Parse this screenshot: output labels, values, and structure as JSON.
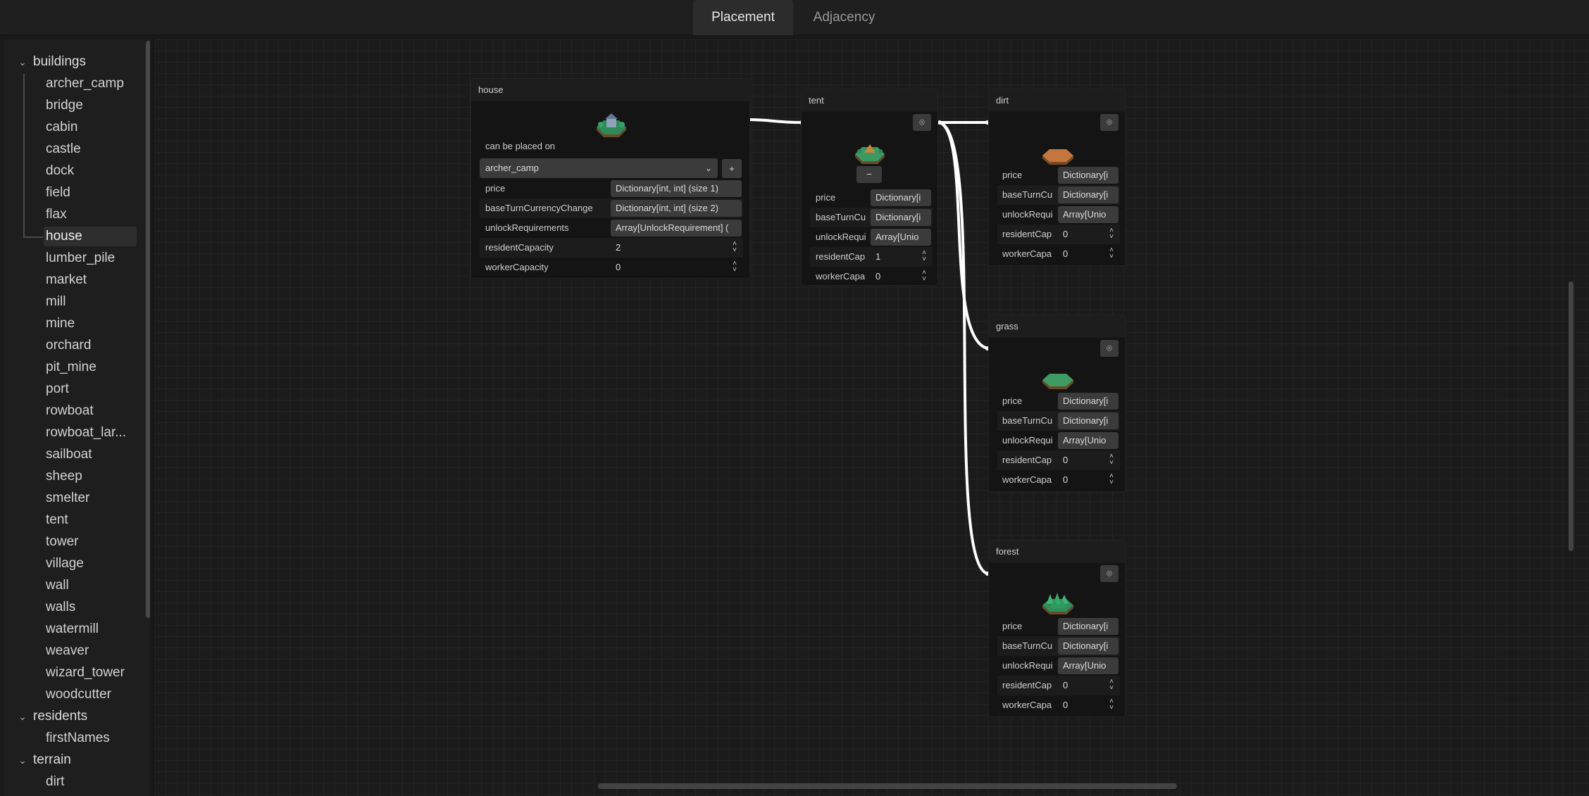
{
  "tabs": [
    {
      "label": "Placement",
      "active": true
    },
    {
      "label": "Adjacency",
      "active": false
    }
  ],
  "tree": {
    "groups": [
      {
        "label": "buildings",
        "items": [
          "archer_camp",
          "bridge",
          "cabin",
          "castle",
          "dock",
          "field",
          "flax",
          "house",
          "lumber_pile",
          "market",
          "mill",
          "mine",
          "orchard",
          "pit_mine",
          "port",
          "rowboat",
          "rowboat_lar...",
          "sailboat",
          "sheep",
          "smelter",
          "tent",
          "tower",
          "village",
          "wall",
          "walls",
          "watermill",
          "weaver",
          "wizard_tower",
          "woodcutter"
        ]
      },
      {
        "label": "residents",
        "items": [
          "firstNames"
        ]
      },
      {
        "label": "terrain",
        "items": [
          "dirt"
        ]
      }
    ],
    "selected": "house"
  },
  "nodes": {
    "house": {
      "title": "house",
      "can_place_label": "can be placed on",
      "select_value": "archer_camp",
      "add_label": "+",
      "props": [
        {
          "label": "price",
          "value": "Dictionary[int, int] (size 1)"
        },
        {
          "label": "baseTurnCurrencyChange",
          "value": "Dictionary[int, int] (size 2)"
        },
        {
          "label": "unlockRequirements",
          "value": "Array[UnlockRequirement] ("
        },
        {
          "label": "residentCapacity",
          "value": "2"
        },
        {
          "label": "workerCapacity",
          "value": "0"
        }
      ]
    },
    "tent": {
      "title": "tent",
      "minus_label": "−",
      "props": [
        {
          "label": "price",
          "value": "Dictionary[i"
        },
        {
          "label": "baseTurnCu",
          "value": "Dictionary[i"
        },
        {
          "label": "unlockRequi",
          "value": "Array[Unio"
        },
        {
          "label": "residentCap",
          "value": "1"
        },
        {
          "label": "workerCapa",
          "value": "0"
        }
      ]
    },
    "dirt": {
      "title": "dirt",
      "props": [
        {
          "label": "price",
          "value": "Dictionary[i"
        },
        {
          "label": "baseTurnCu",
          "value": "Dictionary[i"
        },
        {
          "label": "unlockRequi",
          "value": "Array[Unio"
        },
        {
          "label": "residentCap",
          "value": "0"
        },
        {
          "label": "workerCapa",
          "value": "0"
        }
      ]
    },
    "grass": {
      "title": "grass",
      "props": [
        {
          "label": "price",
          "value": "Dictionary[i"
        },
        {
          "label": "baseTurnCu",
          "value": "Dictionary[i"
        },
        {
          "label": "unlockRequi",
          "value": "Array[Unio"
        },
        {
          "label": "residentCap",
          "value": "0"
        },
        {
          "label": "workerCapa",
          "value": "0"
        }
      ]
    },
    "forest": {
      "title": "forest",
      "props": [
        {
          "label": "price",
          "value": "Dictionary[i"
        },
        {
          "label": "baseTurnCu",
          "value": "Dictionary[i"
        },
        {
          "label": "unlockRequi",
          "value": "Array[Unio"
        },
        {
          "label": "residentCap",
          "value": "0"
        },
        {
          "label": "workerCapa",
          "value": "0"
        }
      ]
    }
  },
  "icons": {
    "house": "house-tile-icon",
    "tent": "tent-tile-icon",
    "dirt": "dirt-tile-icon",
    "grass": "grass-tile-icon",
    "forest": "forest-tile-icon",
    "link": "link-icon"
  },
  "colors": {
    "dirt": "#c4763e",
    "grass": "#3f9a63",
    "forest": "#2f8f5a",
    "wire": "#ffffff"
  }
}
